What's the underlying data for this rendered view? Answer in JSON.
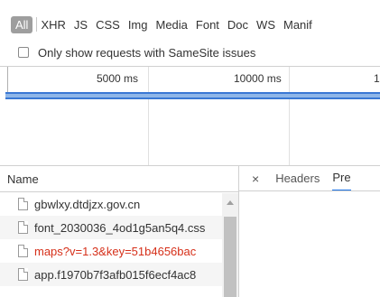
{
  "filter_bar": {
    "all_label": "All",
    "types": [
      "XHR",
      "JS",
      "CSS",
      "Img",
      "Media",
      "Font",
      "Doc",
      "WS",
      "Manif"
    ]
  },
  "samesite": {
    "label": "Only show requests with SameSite issues",
    "checked": false
  },
  "overview": {
    "ticks": [
      "5000 ms",
      "10000 ms",
      "1"
    ]
  },
  "requests": {
    "header": "Name",
    "rows": [
      {
        "name": "gbwlxy.dtdjzx.gov.cn",
        "status": "ok"
      },
      {
        "name": "font_2030036_4od1g5an5q4.css",
        "status": "ok"
      },
      {
        "name": "maps?v=1.3&key=51b4656bac",
        "status": "error"
      },
      {
        "name": "app.f1970b7f3afb015f6ecf4ac8",
        "status": "ok"
      }
    ]
  },
  "detail_tabs": {
    "close_label": "×",
    "headers_label": "Headers",
    "preview_label": "Pre"
  },
  "colors": {
    "error_text": "#d6301a",
    "timeline_bar": "#3a78d4",
    "active_tab": "#1a73e8"
  }
}
